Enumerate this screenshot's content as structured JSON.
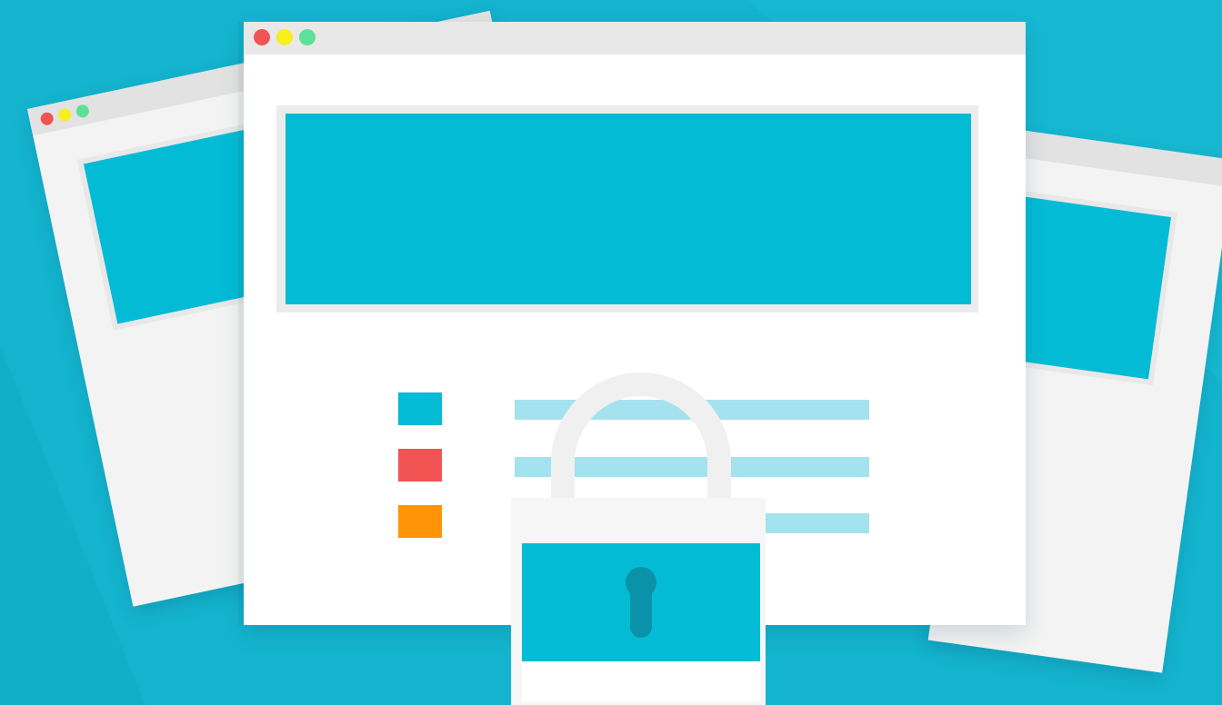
{
  "colors": {
    "background": "#14b4cf",
    "accent": "#04bbd6",
    "line": "#a3e2ee",
    "dot_red": "#f25454",
    "dot_yellow": "#f5f01e",
    "dot_green": "#5fe09a",
    "square_red": "#f25454",
    "square_orange": "#ff9408"
  },
  "icons": {
    "window_controls": [
      "close-dot",
      "minimize-dot",
      "maximize-dot"
    ],
    "center": "padlock-icon"
  }
}
